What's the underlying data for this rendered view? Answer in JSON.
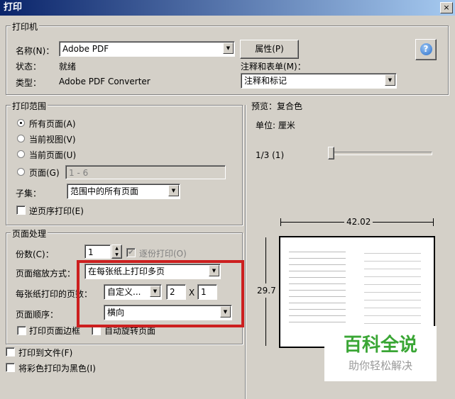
{
  "window": {
    "title": "打印",
    "close": "×"
  },
  "printer": {
    "group": "打印机",
    "name_label": "名称(N)：",
    "name_value": "Adobe PDF",
    "properties": "属性(P)",
    "status_label": "状态：",
    "status_value": "就绪",
    "type_label": "类型：",
    "type_value": "Adobe PDF Converter",
    "comments_label": "注释和表单(M)：",
    "comments_value": "注释和标记",
    "help": "?"
  },
  "range": {
    "group": "打印范围",
    "all": "所有页面(A)",
    "current_view": "当前视图(V)",
    "current_page": "当前页面(U)",
    "pages": "页面(G)",
    "pages_value": "1 - 6",
    "subset_label": "子集：",
    "subset_value": "范围中的所有页面",
    "reverse": "逆页序打印(E)"
  },
  "handling": {
    "group": "页面处理",
    "copies_label": "份数(C)：",
    "copies_value": "1",
    "collate": "逐份打印(O)",
    "scaling_label": "页面缩放方式：",
    "scaling_value": "在每张纸上打印多页",
    "pps_label": "每张纸打印的页数：",
    "pps_value": "自定义...",
    "pps_x": "2",
    "pps_times": "X",
    "pps_y": "1",
    "order_label": "页面顺序：",
    "order_value": "横向",
    "print_border": "打印页面边框",
    "auto_rotate": "自动旋转页面"
  },
  "print_to_file": "打印到文件(F)",
  "print_black": "将彩色打印为黑色(I)",
  "preview": {
    "group": "预览：复合色",
    "unit": "单位: 厘米",
    "page": "1/3 (1)",
    "width": "42.02",
    "height": "29.7",
    "progress": 0.0
  },
  "watermark": {
    "brand": "百科全说",
    "slogan": "助你轻松解决"
  },
  "colors": {
    "highlight": "#cc1f1f",
    "brand": "#3aa635"
  }
}
